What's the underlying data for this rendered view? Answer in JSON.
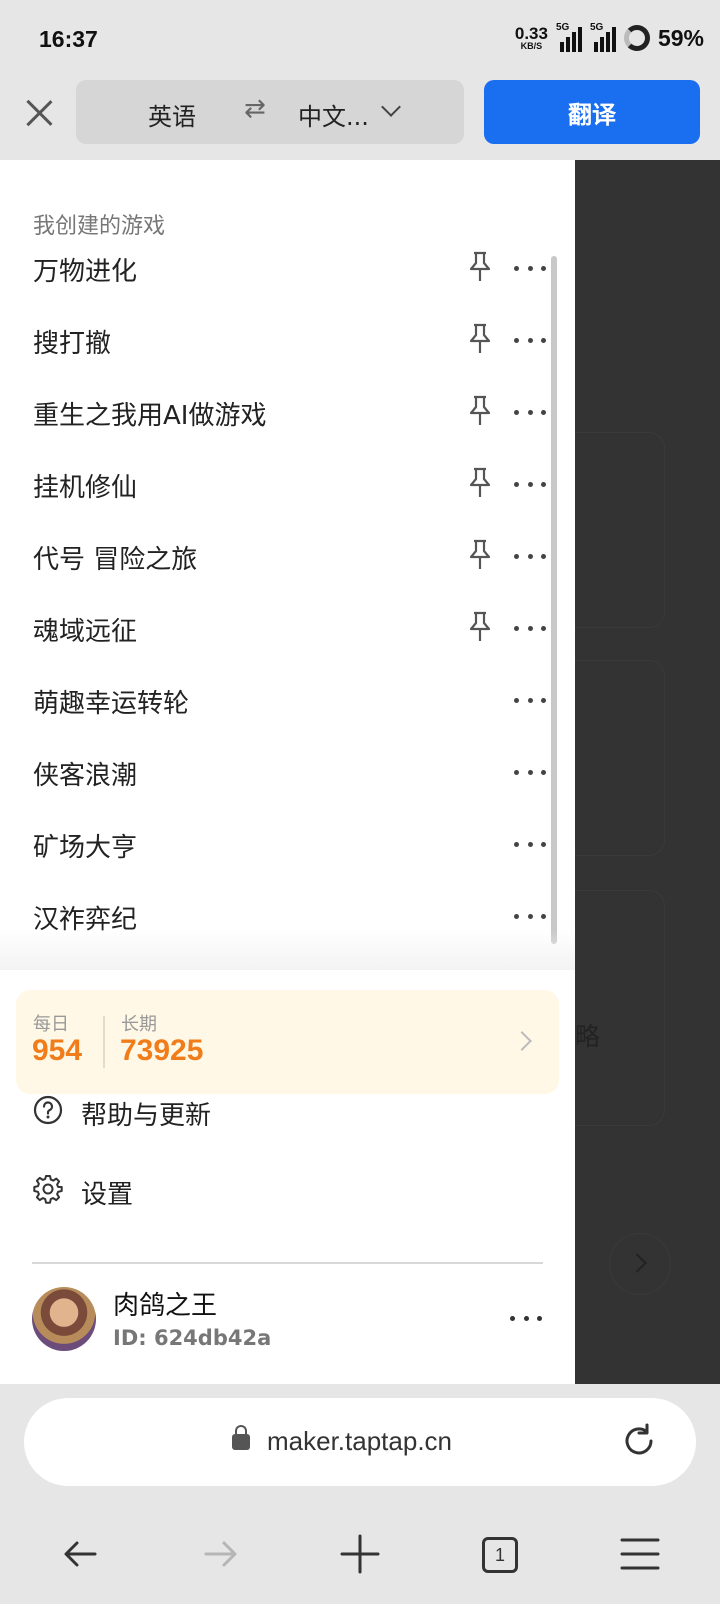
{
  "status_bar": {
    "time": "16:37",
    "net_speed": "0.33",
    "net_unit": "KB/S",
    "sim1_tag": "5G",
    "sim2_tag": "5G",
    "battery": "59%"
  },
  "translate_bar": {
    "source_lang": "英语",
    "swap_symbol": "⇄",
    "target_lang": "中文...",
    "translate_button": "翻译",
    "accent_color": "#1a6ef0"
  },
  "drawer": {
    "section_title": "我创建的游戏",
    "games": [
      {
        "name": "万物进化",
        "pinned": true
      },
      {
        "name": "搜打撤",
        "pinned": true
      },
      {
        "name": "重生之我用AI做游戏",
        "pinned": true
      },
      {
        "name": "挂机修仙",
        "pinned": true
      },
      {
        "name": "代号 冒险之旅",
        "pinned": true
      },
      {
        "name": "魂域远征",
        "pinned": true
      },
      {
        "name": "萌趣幸运转轮",
        "pinned": false
      },
      {
        "name": "侠客浪潮",
        "pinned": false
      },
      {
        "name": "矿场大亨",
        "pinned": false
      },
      {
        "name": "汉祚弈纪",
        "pinned": false
      }
    ],
    "points": {
      "daily_label": "每日",
      "daily_value": "954",
      "long_label": "长期",
      "long_value": "73925",
      "value_color": "#f07d1a"
    },
    "menu": {
      "help_label": "帮助与更新",
      "settings_label": "设置"
    },
    "user": {
      "name": "肉鸽之王",
      "id": "ID: 624db42a"
    }
  },
  "background_page": {
    "partial_text": "略"
  },
  "browser": {
    "url": "maker.taptap.cn",
    "tab_count": "1"
  }
}
